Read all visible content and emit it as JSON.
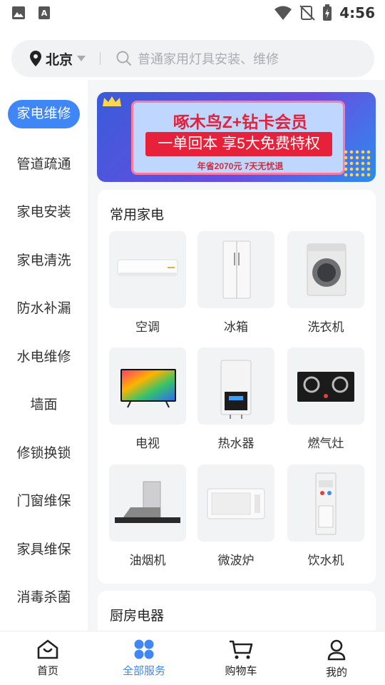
{
  "status_bar": {
    "time": "4:56"
  },
  "header": {
    "city": "北京",
    "search_placeholder": "普通家用灯具安装、维修"
  },
  "sidebar": {
    "items": [
      {
        "label": "家电维修",
        "active": true
      },
      {
        "label": "管道疏通"
      },
      {
        "label": "家电安装"
      },
      {
        "label": "家电清洗"
      },
      {
        "label": "防水补漏"
      },
      {
        "label": "水电维修"
      },
      {
        "label": "墙面"
      },
      {
        "label": "修锁换锁"
      },
      {
        "label": "门窗维保"
      },
      {
        "label": "家具维保"
      },
      {
        "label": "消毒杀菌"
      }
    ]
  },
  "banner": {
    "title": "啄木鸟Z+钻卡会员",
    "ribbon": "一单回本 享5大免费特权",
    "sub": "年省2070元 7天无忧退"
  },
  "sections": [
    {
      "title": "常用家电",
      "items": [
        {
          "label": "空调",
          "icon": "air-conditioner-icon"
        },
        {
          "label": "冰箱",
          "icon": "fridge-icon"
        },
        {
          "label": "洗衣机",
          "icon": "washing-machine-icon"
        },
        {
          "label": "电视",
          "icon": "tv-icon"
        },
        {
          "label": "热水器",
          "icon": "water-heater-icon"
        },
        {
          "label": "燃气灶",
          "icon": "gas-stove-icon"
        },
        {
          "label": "油烟机",
          "icon": "range-hood-icon"
        },
        {
          "label": "微波炉",
          "icon": "microwave-icon"
        },
        {
          "label": "饮水机",
          "icon": "water-dispenser-icon"
        }
      ]
    },
    {
      "title": "厨房电器"
    }
  ],
  "bottom_nav": {
    "items": [
      {
        "label": "首页",
        "icon": "home-icon"
      },
      {
        "label": "全部服务",
        "icon": "grid-icon",
        "active": true
      },
      {
        "label": "购物车",
        "icon": "cart-icon"
      },
      {
        "label": "我的",
        "icon": "user-icon"
      }
    ]
  },
  "colors": {
    "accent": "#3f86f6",
    "banner_red": "#e8213b"
  }
}
